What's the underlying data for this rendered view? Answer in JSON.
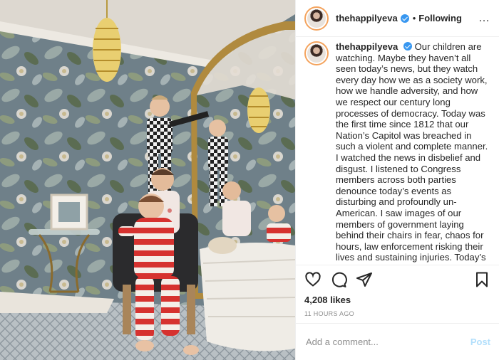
{
  "header": {
    "username": "thehappilyeva",
    "separator": "•",
    "follow_label": "Following",
    "more_icon": "…"
  },
  "caption": {
    "username": "thehappilyeva",
    "text": "Our children are watching. Maybe they haven’t all seen today’s news, but they watch every day how we as a society work, how we handle adversity, and how we respect our century long processes of democracy. Today was the first time since 1812 that our Nation’s Capitol was breached in such a violent and complete manner. I watched the news in disbelief and disgust. I listened to Congress members across both parties denounce today’s events as disturbing and profoundly un-American. I saw images of our members of government laying behind their chairs in fear, chaos for hours, law enforcement risking their lives and sustaining injuries. Today’s events were so deeply sad to watch"
  },
  "actions": {
    "like_icon": "heart-icon",
    "comment_icon": "comment-icon",
    "share_icon": "share-icon",
    "save_icon": "bookmark-icon"
  },
  "likes": "4,208 likes",
  "timestamp": "11 HOURS AGO",
  "comment_box": {
    "placeholder": "Add a comment...",
    "post_label": "Post"
  },
  "colors": {
    "verified": "#3897f0",
    "post_disabled": "#b2dffc",
    "muted": "#8e8e8e"
  }
}
